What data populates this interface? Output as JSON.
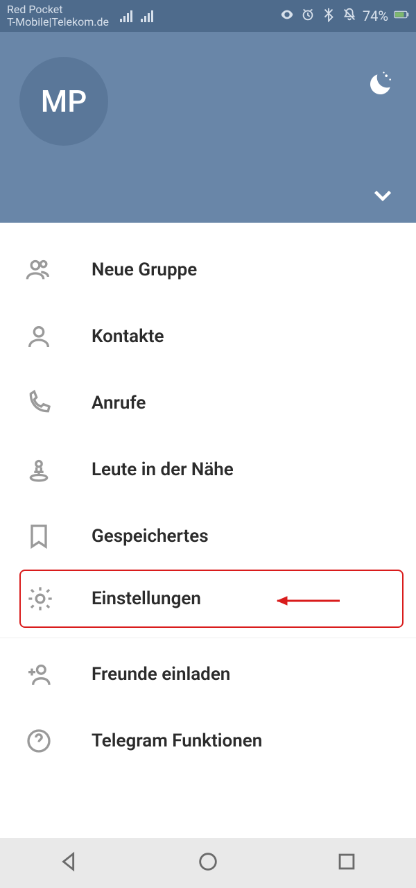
{
  "statusbar": {
    "carrier_line1": "Red Pocket",
    "carrier_line2": "T-Mobile|Telekom.de",
    "battery_pct": "74%"
  },
  "profile": {
    "avatar_initials": "MP"
  },
  "menu": {
    "new_group": "Neue Gruppe",
    "contacts": "Kontakte",
    "calls": "Anrufe",
    "people_nearby": "Leute in der Nähe",
    "saved": "Gespeichertes",
    "settings": "Einstellungen",
    "invite_friends": "Freunde einladen",
    "telegram_features": "Telegram Funktionen"
  }
}
